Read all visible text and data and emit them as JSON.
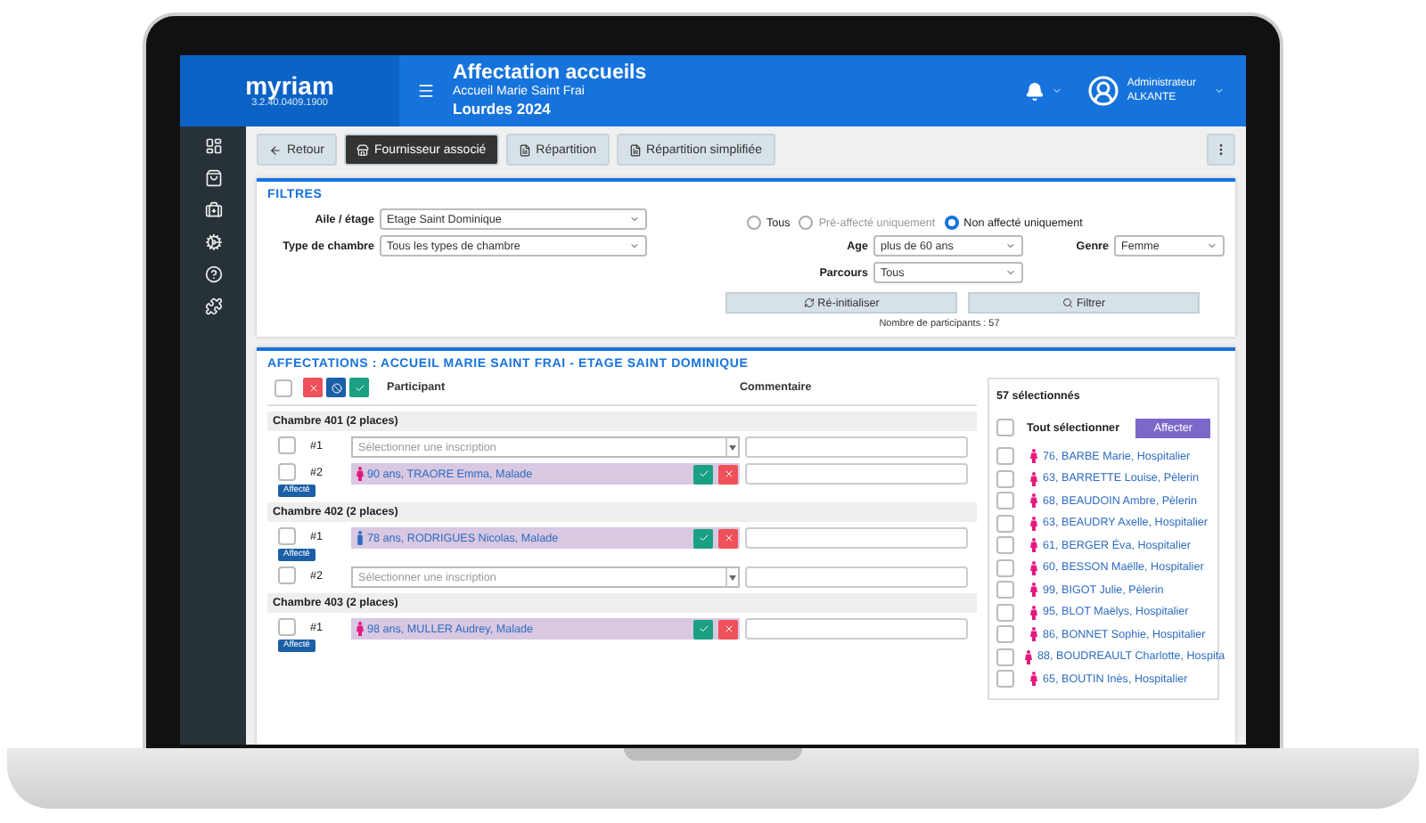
{
  "header": {
    "app_name": "myriam",
    "version": "3.2.40.0409.1900",
    "title": "Affectation accueils",
    "subtitle": "Accueil Marie Saint Frai",
    "event": "Lourdes 2024",
    "user": {
      "role": "Administrateur",
      "name": "ALKANTE"
    }
  },
  "toolbar": [
    {
      "label": "Retour",
      "kind": "back",
      "selected": false
    },
    {
      "label": "Fournisseur associé",
      "kind": "store",
      "selected": true
    },
    {
      "label": "Répartition",
      "kind": "pdf",
      "selected": false
    },
    {
      "label": "Répartition simplifiée",
      "kind": "pdf",
      "selected": false
    }
  ],
  "filters": {
    "title": "FILTRES",
    "left": [
      {
        "label": "Aile / étage",
        "value": "Etage Saint Dominique"
      },
      {
        "label": "Type de chambre",
        "value": "Tous les types de chambre"
      }
    ],
    "radios": [
      {
        "label": "Tous",
        "selected": false,
        "disabled": false
      },
      {
        "label": "Pré-affecté uniquement",
        "selected": false,
        "disabled": true
      },
      {
        "label": "Non affecté uniquement",
        "selected": true,
        "disabled": false
      }
    ],
    "age": {
      "label": "Age",
      "value": "plus de 60 ans"
    },
    "genre": {
      "label": "Genre",
      "value": "Femme"
    },
    "parcours": {
      "label": "Parcours",
      "value": "Tous"
    },
    "reset_button": "Ré-initialiser",
    "filter_button": "Filtrer",
    "count": "Nombre de participants : 57"
  },
  "affectations": {
    "title": "AFFECTATIONS : ACCUEIL MARIE SAINT FRAI - ETAGE SAINT DOMINIQUE",
    "columns": [
      "Participant",
      "Commentaire"
    ],
    "header_checkbox": {
      "checked": false
    },
    "rooms": [
      {
        "title": "Chambre 401 (2 places)",
        "slots": [
          {
            "number": "#1",
            "kind": "empty",
            "checked": false,
            "placeholder": "Sélectionner une inscription"
          },
          {
            "number": "#2",
            "kind": "assigned",
            "checked": false,
            "participant": {
              "text": "90 ans, TRAORE Emma, Malade",
              "kind": "female"
            },
            "badge": "Affecté"
          }
        ]
      },
      {
        "title": "Chambre 402 (2 places)",
        "slots": [
          {
            "number": "#1",
            "kind": "assigned",
            "checked": false,
            "participant": {
              "text": "78 ans, RODRIGUES Nicolas, Malade",
              "kind": "male"
            },
            "badge": "Affecté"
          },
          {
            "number": "#2",
            "kind": "empty",
            "checked": false,
            "placeholder": "Sélectionner une inscription"
          }
        ]
      },
      {
        "title": "Chambre 403 (2 places)",
        "slots": [
          {
            "number": "#1",
            "kind": "assigned",
            "checked": false,
            "participant": {
              "text": "98 ans, MULLER Audrey, Malade",
              "kind": "female"
            },
            "badge": "Affecté"
          }
        ]
      }
    ]
  },
  "selection": {
    "count": "57 sélectionnés",
    "select_all": {
      "label": "Tout sélectionner",
      "checked": false
    },
    "button": "Affecter",
    "items": [
      {
        "text": "76, BARBE Marie, Hospitalier",
        "kind": "female",
        "checked": false
      },
      {
        "text": "63, BARRETTE Louise, Pèlerin",
        "kind": "female",
        "checked": false
      },
      {
        "text": "68, BEAUDOIN Ambre, Pèlerin",
        "kind": "female",
        "checked": false
      },
      {
        "text": "63, BEAUDRY Axelle, Hospitalier",
        "kind": "female",
        "checked": false
      },
      {
        "text": "61, BERGER Éva, Hospitalier",
        "kind": "female",
        "checked": false
      },
      {
        "text": "60, BESSON Maëlle, Hospitalier",
        "kind": "female",
        "checked": false
      },
      {
        "text": "99, BIGOT Julie, Pèlerin",
        "kind": "female",
        "checked": false
      },
      {
        "text": "95, BLOT Maëlys, Hospitalier",
        "kind": "female",
        "checked": false
      },
      {
        "text": "86, BONNET Sophie, Hospitalier",
        "kind": "female",
        "checked": false
      },
      {
        "text": "88, BOUDREAULT Charlotte, Hospita",
        "kind": "female",
        "checked": false
      },
      {
        "text": "65, BOUTIN Inès, Hospitalier",
        "kind": "female",
        "checked": false
      }
    ]
  }
}
